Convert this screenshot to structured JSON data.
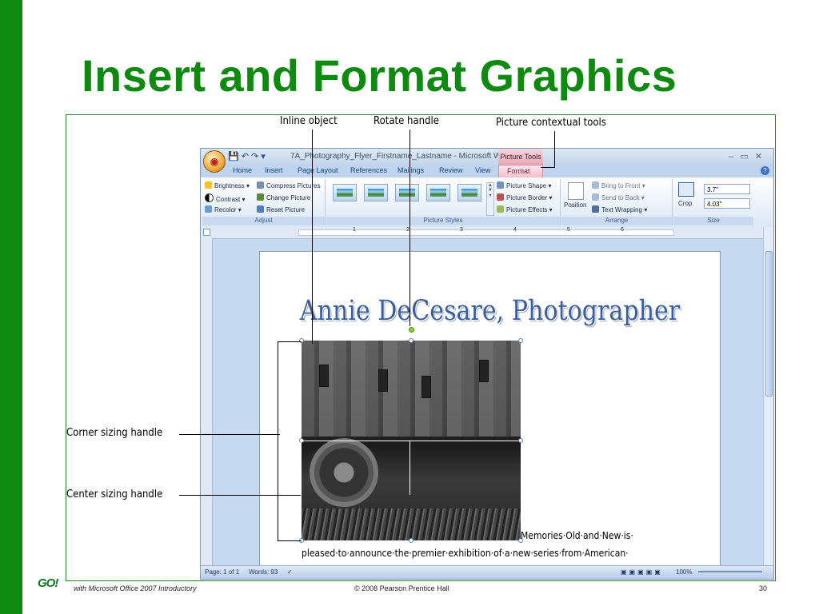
{
  "slide": {
    "title": "Insert and Format Graphics",
    "accent_color": "#0d8a0f"
  },
  "callouts": {
    "inline_object": "Inline object",
    "rotate_handle": "Rotate handle",
    "picture_tools": "Picture contextual tools",
    "corner_sizing": "Corner sizing handle",
    "center_sizing": "Center sizing handle"
  },
  "word": {
    "window_title": "7A_Photography_Flyer_Firstname_Lastname - Microsoft Wo...",
    "contextual_tag": "Picture Tools",
    "tabs": [
      "Home",
      "Insert",
      "Page Layout",
      "References",
      "Mailings",
      "Review",
      "View",
      "Format"
    ],
    "active_tab": "Format",
    "ribbon": {
      "adjust": {
        "label": "Adjust",
        "items": [
          "Brightness ▾",
          "Contrast ▾",
          "Recolor ▾",
          "Compress Pictures",
          "Change Picture",
          "Reset Picture"
        ]
      },
      "picture_styles": {
        "label": "Picture Styles",
        "items": [
          "Picture Shape ▾",
          "Picture Border ▾",
          "Picture Effects ▾"
        ]
      },
      "arrange": {
        "label": "Arrange",
        "position": "Position",
        "items": [
          "Bring to Front ▾",
          "Send to Back ▾",
          "Text Wrapping ▾"
        ]
      },
      "size": {
        "label": "Size",
        "crop": "Crop",
        "height": "3.7\"",
        "width": "4.03\""
      }
    },
    "ruler_numbers": [
      "1",
      "2",
      "3",
      "4",
      "5",
      "6"
    ],
    "document": {
      "heading": "Annie DeCesare, Photographer",
      "line1": "Memories·Old·and·New·is·",
      "line2": "pleased·to·announce·the·premier·exhibition·of·a·new·series·from·American·"
    },
    "status": {
      "page": "Page: 1 of 1",
      "words": "Words: 93",
      "zoom": "100%"
    }
  },
  "footer": {
    "logo": "GO!",
    "series": "with Microsoft Office 2007 Introductory",
    "copyright": "© 2008 Pearson Prentice Hall",
    "page_number": "30"
  }
}
